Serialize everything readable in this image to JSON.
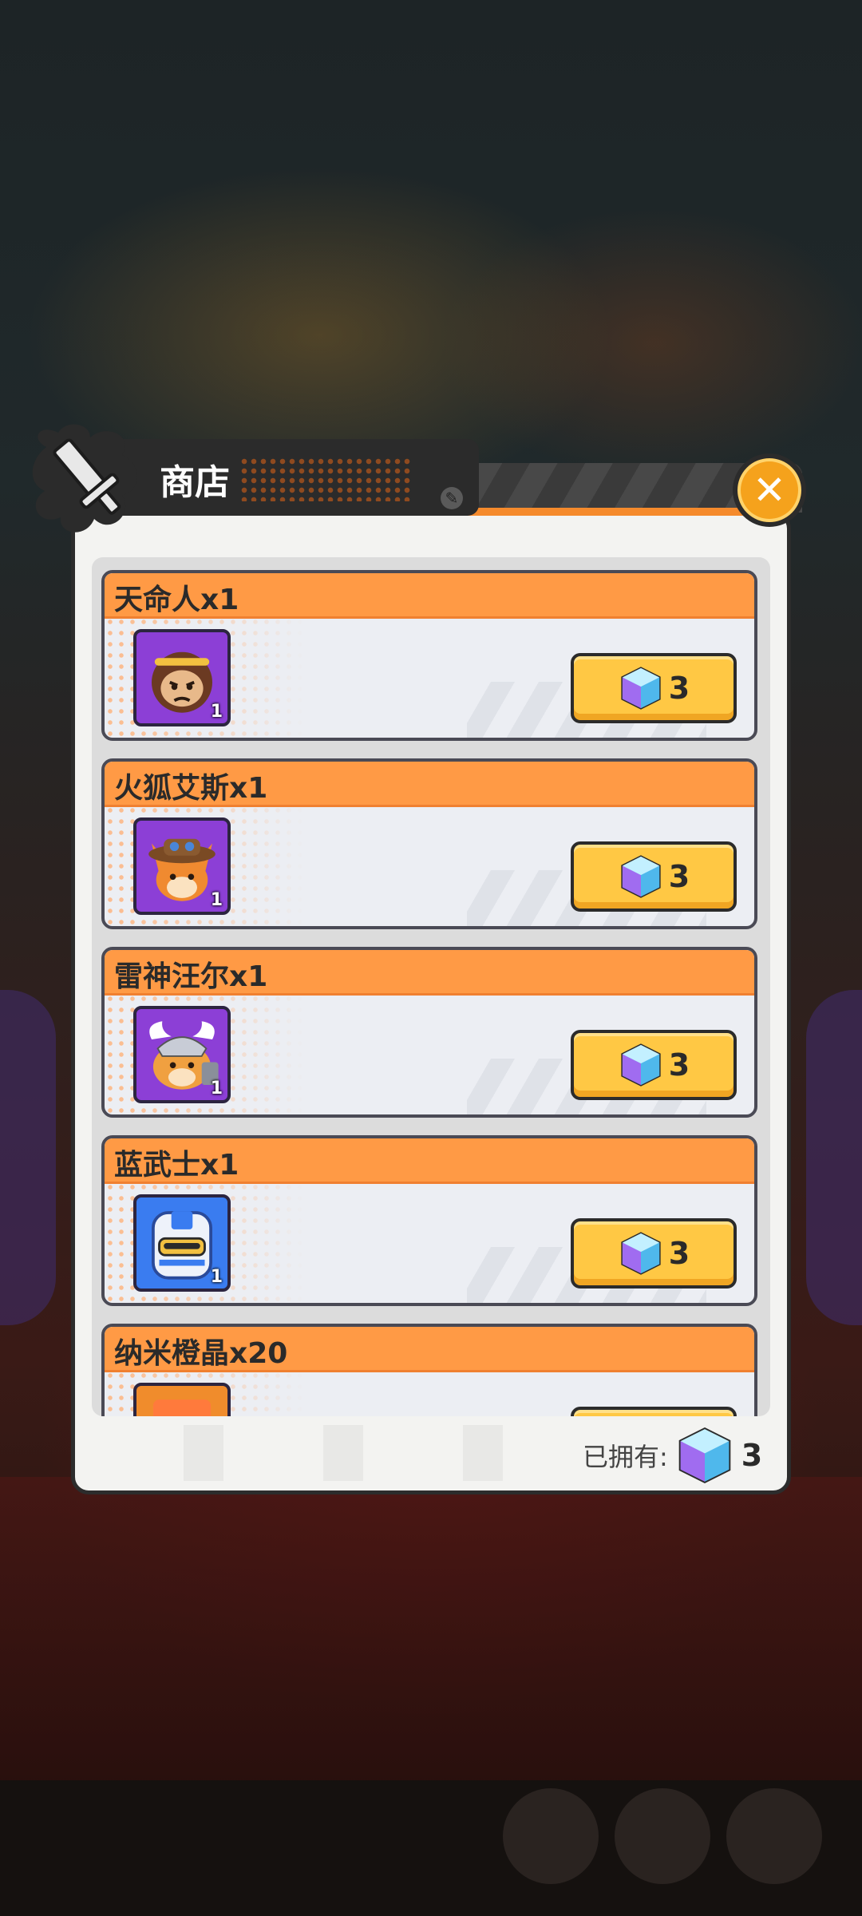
{
  "shop": {
    "title": "商店",
    "close_icon": "close-icon",
    "items": [
      {
        "name": "天命人x1",
        "count": "1",
        "price": "3",
        "icon": "monkey-hero-icon",
        "color": "#8c3fd6"
      },
      {
        "name": "火狐艾斯x1",
        "count": "1",
        "price": "3",
        "icon": "fox-hero-icon",
        "color": "#8c3fd6"
      },
      {
        "name": "雷神汪尔x1",
        "count": "1",
        "price": "3",
        "icon": "thor-dog-hero-icon",
        "color": "#8c3fd6"
      },
      {
        "name": "蓝武士x1",
        "count": "1",
        "price": "3",
        "icon": "blue-knight-hero-icon",
        "color": "#3a7cf0"
      },
      {
        "name": "纳米橙晶x20",
        "count": "",
        "price": "",
        "icon": "nano-orange-crystal-icon",
        "color": "#f08c2c"
      }
    ],
    "owned_label": "已拥有:",
    "owned_count": "3",
    "currency_icon": "diamond-gem-icon"
  }
}
